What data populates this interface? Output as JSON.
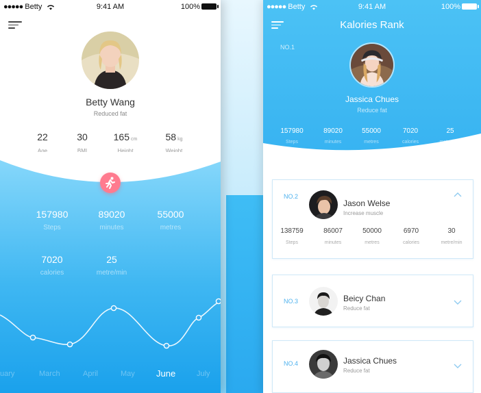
{
  "status_bar": {
    "carrier": "Betty",
    "time": "9:41 AM",
    "battery": "100%"
  },
  "profile_screen": {
    "user": {
      "name": "Betty Wang",
      "goal": "Reduced fat"
    },
    "metrics": [
      {
        "value": "22",
        "unit": "",
        "label": "Age"
      },
      {
        "value": "30",
        "unit": "",
        "label": "BMI"
      },
      {
        "value": "165",
        "unit": "cm",
        "label": "Height"
      },
      {
        "value": "58",
        "unit": "kg",
        "label": "Weight"
      }
    ],
    "stats": [
      {
        "value": "157980",
        "label": "Steps"
      },
      {
        "value": "89020",
        "label": "minutes"
      },
      {
        "value": "55000",
        "label": "metres"
      },
      {
        "value": "7020",
        "label": "calories"
      },
      {
        "value": "25",
        "label": "metre/min"
      }
    ],
    "months": [
      "uary",
      "March",
      "April",
      "May",
      "June",
      "July"
    ],
    "selected_month": "June"
  },
  "rank_screen": {
    "title": "Kalories Rank",
    "top": {
      "rank": "NO.1",
      "name": "Jassica Chues",
      "goal": "Reduce fat",
      "stats": [
        {
          "value": "157980",
          "label": "Steps"
        },
        {
          "value": "89020",
          "label": "minutes"
        },
        {
          "value": "55000",
          "label": "metres"
        },
        {
          "value": "7020",
          "label": "calories"
        },
        {
          "value": "25",
          "label": "metre/min"
        }
      ]
    },
    "entries": [
      {
        "rank": "NO.2",
        "name": "Jason Welse",
        "goal": "Increase muscle",
        "expanded": true,
        "stats": [
          {
            "value": "138759",
            "label": "Steps"
          },
          {
            "value": "86007",
            "label": "minutes"
          },
          {
            "value": "50000",
            "label": "metres"
          },
          {
            "value": "6970",
            "label": "calories"
          },
          {
            "value": "30",
            "label": "metre/min"
          }
        ]
      },
      {
        "rank": "NO.3",
        "name": "Beicy Chan",
        "goal": "Reduce fat",
        "expanded": false
      },
      {
        "rank": "NO.4",
        "name": "Jassica Chues",
        "goal": "Reduce fat",
        "expanded": false
      }
    ]
  },
  "icons": {
    "menu": "menu-icon",
    "wifi": "wifi-icon",
    "battery": "battery-icon",
    "run": "running-icon",
    "expand": "chevron-down-icon",
    "collapse": "chevron-up-icon"
  },
  "colors": {
    "primary_blue": "#3fb7f2",
    "accent_pink": "#ff7b8f",
    "rank_blue": "#4fb2ee"
  }
}
